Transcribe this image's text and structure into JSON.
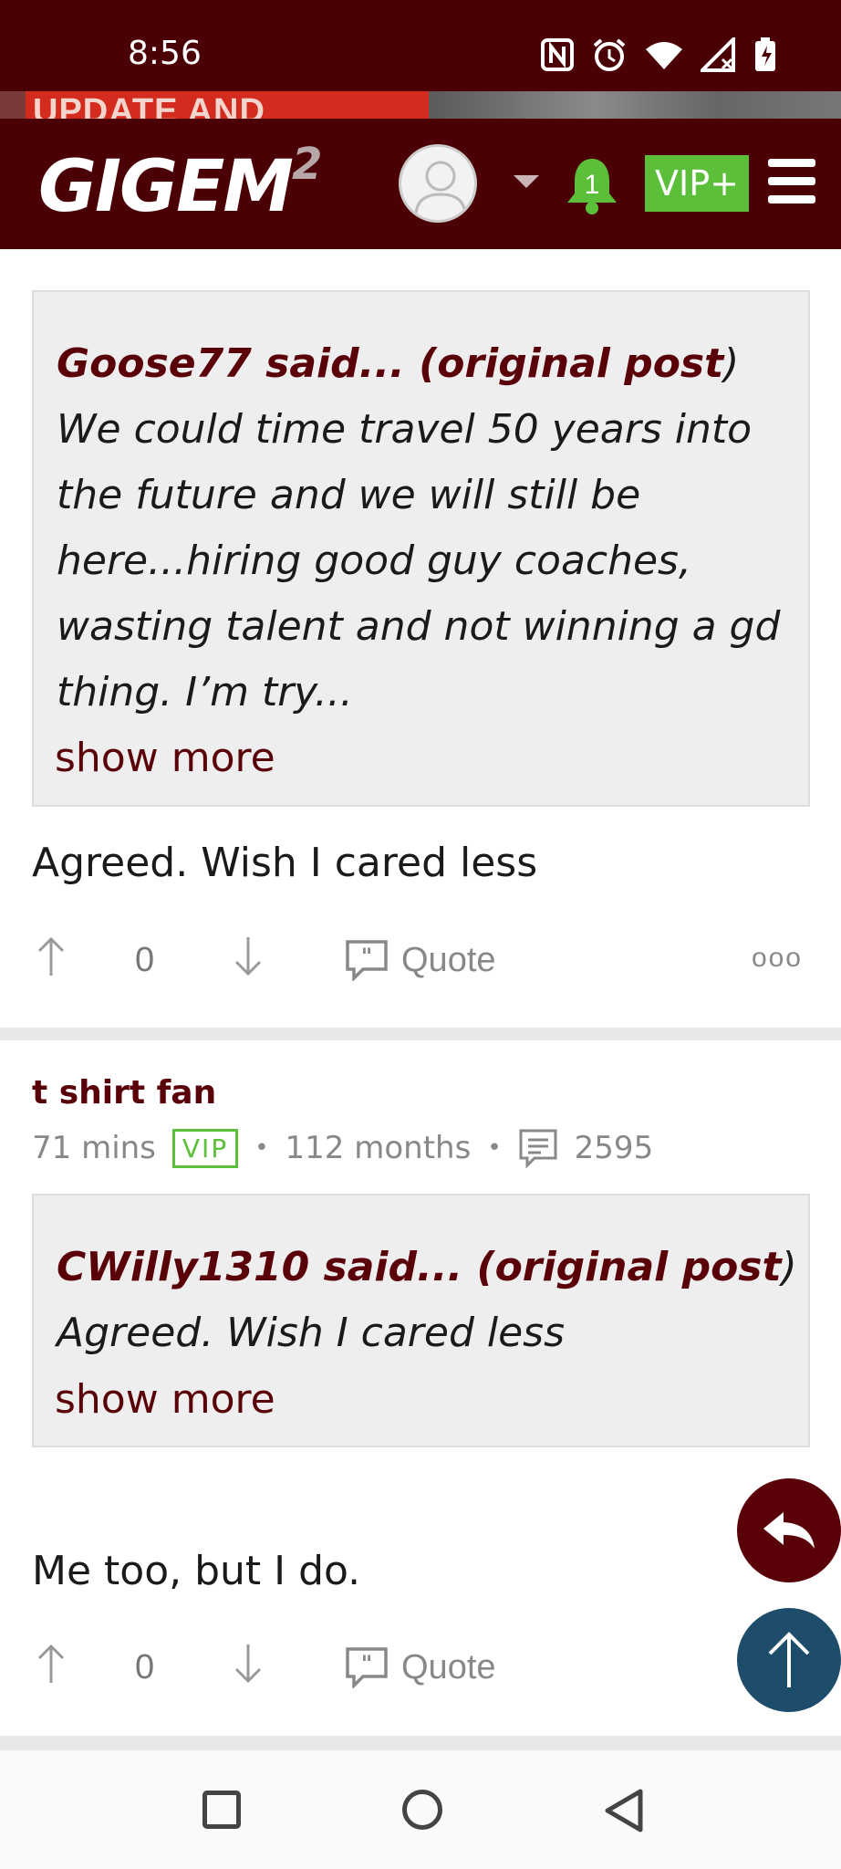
{
  "status_bar": {
    "time": "8:56"
  },
  "ad": {
    "text": "UPDATE AND"
  },
  "header": {
    "logo_main": "GIGEM",
    "logo_sup": "2",
    "notification_count": "1",
    "vip_label": "VIP+"
  },
  "posts": [
    {
      "quote": {
        "author_line": "Goose77 said... (original post)",
        "author_name": "Goose77 said... (",
        "author_link": "original post",
        "author_close": ")",
        "text": "We could time travel 50 years into the future and we will still be here...hiring good guy coaches, wasting talent and not winning a gd thing. I’m try..."
      },
      "show_more": "show more",
      "body": "Agreed. Wish I cared less",
      "votes": "0",
      "quote_label": "Quote",
      "more": "ooo"
    },
    {
      "username": "t shirt fan",
      "time_ago": "71 mins",
      "badge": "VIP",
      "tenure": "112 months",
      "post_count": "2595",
      "quote": {
        "author_name": "CWilly1310 said... (",
        "author_link": "original post",
        "author_close": ")",
        "text": " Agreed. Wish I cared less"
      },
      "show_more": "show more",
      "body": "Me too, but I do.",
      "votes": "0",
      "quote_label": "Quote"
    }
  ]
}
